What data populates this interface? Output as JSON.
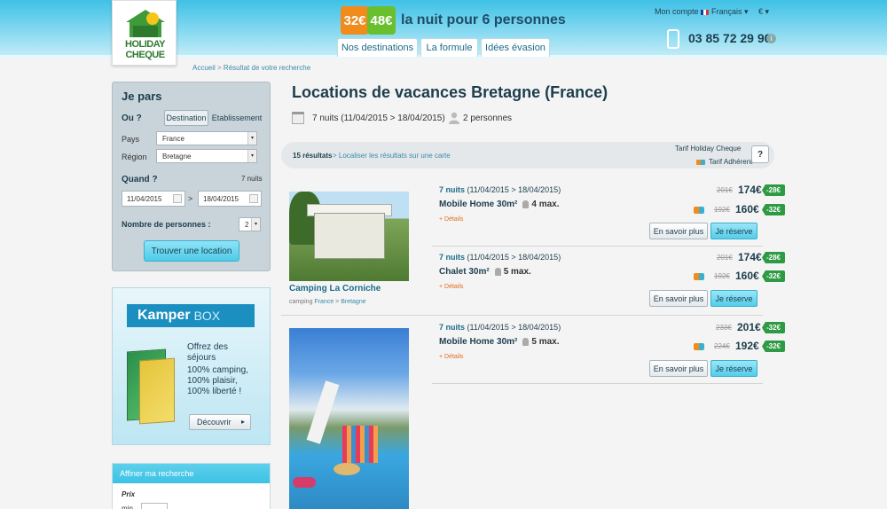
{
  "header": {
    "logo_line1": "HOLIDAY",
    "logo_line2": "CHEQUE",
    "price_badge_1": "32€",
    "price_badge_2": "48€",
    "tagline": "la nuit pour 6 personnes",
    "nav": [
      "Nos destinations",
      "La formule",
      "Idées évasion"
    ],
    "account": "Mon compte",
    "language": "Français ▾",
    "currency": "€ ▾",
    "phone": "03 85 72 29 90",
    "info": "i",
    "colors": {
      "primary": "#3fc1e6",
      "discount": "#2e9a43",
      "accent": "#e36c1c"
    }
  },
  "breadcrumb": {
    "home": "Accueil",
    "sep": " > ",
    "current": "Résultat de votre recherche"
  },
  "search": {
    "title": "Je pars",
    "ou_label": "Ou ?",
    "toggle_destination": "Destination",
    "toggle_etablissement": "Etablissement",
    "pays_label": "Pays",
    "pays_value": "France",
    "region_label": "Région",
    "region_value": "Bretagne",
    "quand_label": "Quand ?",
    "nights": "7 nuits",
    "date_from": "11/04/2015",
    "date_sep": ">",
    "date_to": "18/04/2015",
    "persons_label": "Nombre de personnes :",
    "persons_value": "2",
    "submit": "Trouver une location"
  },
  "ad": {
    "brand": "Kamper",
    "brand_suffix": "BOX",
    "line1": "Offrez des",
    "line2": "séjours",
    "line3": "100% camping,",
    "line4": "100% plaisir,",
    "line5": "100% liberté !",
    "button": "Découvrir"
  },
  "refine": {
    "title": "Affiner ma recherche",
    "prix": "Prix",
    "min": "min"
  },
  "main": {
    "title": "Locations de vacances Bretagne (France)",
    "dates": "7 nuits (11/04/2015 > 18/04/2015)",
    "persons": "2 personnes",
    "results_count": "15 résultats",
    "results_link": " > Localiser les résultats sur une carte",
    "tarif_hc": "Tarif Holiday Cheque",
    "tarif_adh": "Tarif Adhérent",
    "help": "?"
  },
  "listings": [
    {
      "camping": "Camping La Corniche",
      "loc_prefix": "camping",
      "loc_country": "France",
      "loc_sep": " > ",
      "loc_region": "Bretagne",
      "offers": [
        {
          "nights": "7 nuits",
          "dates": " (11/04/2015 > 18/04/2015)",
          "type": "Mobile Home 30m²",
          "pers": "4 max.",
          "details": "+ Détails",
          "old1": "201€",
          "new1": "174€",
          "disc1": "-28€",
          "old2": "192€",
          "new2": "160€",
          "disc2": "-32€",
          "btn_more": "En savoir plus",
          "btn_book": "Je réserve"
        },
        {
          "nights": "7 nuits",
          "dates": " (11/04/2015 > 18/04/2015)",
          "type": "Chalet 30m²",
          "pers": "5 max.",
          "details": "+ Détails",
          "old1": "201€",
          "new1": "174€",
          "disc1": "-28€",
          "old2": "192€",
          "new2": "160€",
          "disc2": "-32€",
          "btn_more": "En savoir plus",
          "btn_book": "Je réserve"
        }
      ]
    },
    {
      "offers": [
        {
          "nights": "7 nuits",
          "dates": " (11/04/2015 > 18/04/2015)",
          "type": "Mobile Home 30m²",
          "pers": "5 max.",
          "details": "+ Détails",
          "old1": "233€",
          "new1": "201€",
          "disc1": "-32€",
          "old2": "224€",
          "new2": "192€",
          "disc2": "-32€",
          "btn_more": "En savoir plus",
          "btn_book": "Je réserve"
        }
      ]
    }
  ]
}
